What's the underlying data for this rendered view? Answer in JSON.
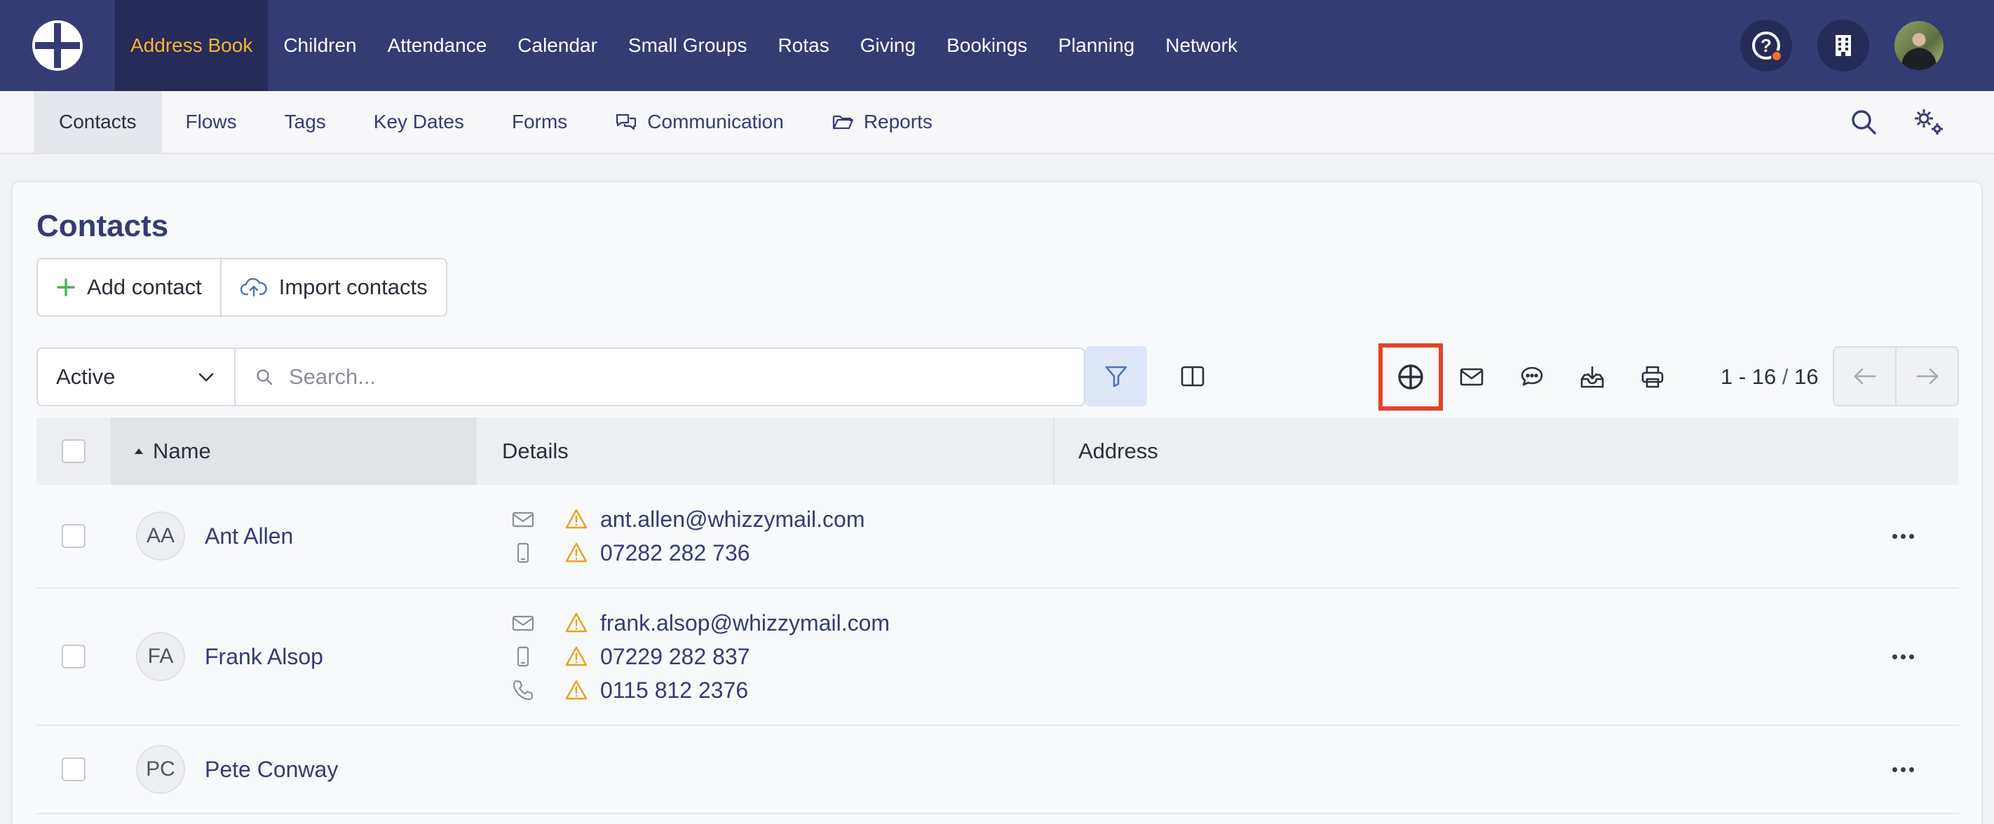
{
  "topnav": {
    "items": [
      "Address Book",
      "Children",
      "Attendance",
      "Calendar",
      "Small Groups",
      "Rotas",
      "Giving",
      "Bookings",
      "Planning",
      "Network"
    ],
    "active_index": 0,
    "active_color": "#f5b731",
    "bar_color": "#353b73"
  },
  "subnav": {
    "items": [
      "Contacts",
      "Flows",
      "Tags",
      "Key Dates",
      "Forms",
      "Communication",
      "Reports"
    ],
    "active_index": 0
  },
  "page": {
    "title": "Contacts",
    "add_contact_label": "Add contact",
    "import_contacts_label": "Import contacts"
  },
  "toolbar": {
    "status_value": "Active",
    "search_placeholder": "Search...",
    "pager_range": "1 - 16",
    "pager_sep": " / ",
    "pager_total": "16",
    "highlight_color": "#e2432a"
  },
  "table": {
    "columns": {
      "name": "Name",
      "details": "Details",
      "address": "Address"
    },
    "rows": [
      {
        "initials": "AA",
        "name": "Ant Allen",
        "details": [
          {
            "type": "email",
            "value": "ant.allen@whizzymail.com"
          },
          {
            "type": "mobile",
            "value": "07282 282 736"
          }
        ]
      },
      {
        "initials": "FA",
        "name": "Frank Alsop",
        "details": [
          {
            "type": "email",
            "value": "frank.alsop@whizzymail.com"
          },
          {
            "type": "mobile",
            "value": "07229 282 837"
          },
          {
            "type": "phone",
            "value": "0115 812 2376"
          }
        ]
      },
      {
        "initials": "PC",
        "name": "Pete Conway",
        "details": []
      }
    ]
  }
}
